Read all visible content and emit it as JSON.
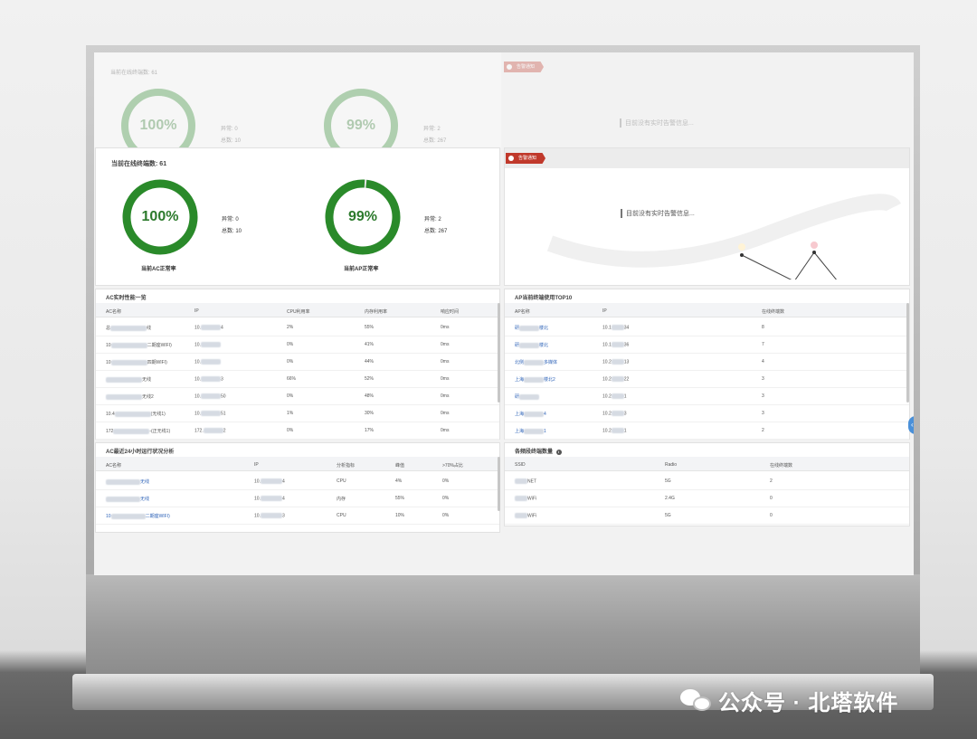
{
  "watermark": {
    "text": "公众号 · 北塔软件",
    "icon": "wechat-icon"
  },
  "online_terminals": {
    "label": "当前在线终端数:",
    "value": "61"
  },
  "ac_gauge": {
    "percent": "100%",
    "level": 1.0,
    "abnormal_label": "异常:",
    "abnormal": "0",
    "total_label": "总数:",
    "total": "10",
    "caption": "当前AC正常率"
  },
  "ap_gauge": {
    "percent": "99%",
    "level": 0.99,
    "abnormal_label": "异常:",
    "abnormal": "2",
    "total_label": "总数:",
    "total": "267",
    "caption": "当前AP正常率"
  },
  "alarm": {
    "tag": "告警通知",
    "empty_text": "目前没有实时告警信息..."
  },
  "ghost": {
    "online_terminals": "当前在线终端数: 61",
    "ac_percent": "100%",
    "ac_abnormal": "异常: 0",
    "ac_total": "总数: 10",
    "ap_percent": "99%",
    "ap_abnormal": "异常: 2",
    "ap_total": "总数: 267",
    "alarm_tag": "告警通知",
    "alarm_text": "目前没有实时告警信息..."
  },
  "ac_realtime": {
    "title": "AC实时性能一览",
    "headers": [
      "AC名称",
      "IP",
      "CPU利用率",
      "内存利用率",
      "响应时间"
    ],
    "rows": [
      {
        "name": "总",
        "name_suffix": "线",
        "ip": "10.",
        "ip_suffix": "4",
        "cpu": "2%",
        "mem": "55%",
        "resp": "0ms"
      },
      {
        "name": "10",
        "name_suffix": "二期座WIFI)",
        "ip": "10.",
        "ip_suffix": "",
        "cpu": "0%",
        "mem": "41%",
        "resp": "0ms"
      },
      {
        "name": "10",
        "name_suffix": "四期WIFI)",
        "ip": "10.",
        "ip_suffix": "",
        "cpu": "0%",
        "mem": "44%",
        "resp": "0ms"
      },
      {
        "name": "",
        "name_suffix": "无线",
        "ip": "10.",
        "ip_suffix": "3",
        "cpu": "66%",
        "mem": "52%",
        "resp": "0ms"
      },
      {
        "name": "",
        "name_suffix": "无线2",
        "ip": "10.",
        "ip_suffix": "50",
        "cpu": "0%",
        "mem": "48%",
        "resp": "0ms"
      },
      {
        "name": "10.4",
        "name_suffix": "(无线1)",
        "ip": "10.",
        "ip_suffix": "51",
        "cpu": "1%",
        "mem": "30%",
        "resp": "0ms"
      },
      {
        "name": "172",
        "name_suffix": "-(正无线1)",
        "ip": "172.",
        "ip_suffix": "2",
        "cpu": "0%",
        "mem": "17%",
        "resp": "0ms"
      }
    ]
  },
  "ap_top10": {
    "title": "AP当前终端使用TOP10",
    "headers": [
      "AP名称",
      "IP",
      "在线终端数"
    ],
    "rows": [
      {
        "name": "研",
        "name_suffix": "楼北",
        "ip": "10.1",
        "ip_suffix": "34",
        "count": "8"
      },
      {
        "name": "研",
        "name_suffix": "楼北",
        "ip": "10.1",
        "ip_suffix": "36",
        "count": "7"
      },
      {
        "name": "北侧",
        "name_suffix": "多媒体",
        "ip": "10.2",
        "ip_suffix": "13",
        "count": "4"
      },
      {
        "name": "上海",
        "name_suffix": "楼北2",
        "ip": "10.2",
        "ip_suffix": "22",
        "count": "3"
      },
      {
        "name": "研",
        "name_suffix": "",
        "ip": "10.2",
        "ip_suffix": "1",
        "count": "3"
      },
      {
        "name": "上海",
        "name_suffix": "4",
        "ip": "10.2",
        "ip_suffix": "3",
        "count": "3"
      },
      {
        "name": "上海",
        "name_suffix": "1",
        "ip": "10.2",
        "ip_suffix": "1",
        "count": "2"
      }
    ]
  },
  "ac_24h": {
    "title": "AC最近24小时运行状况分析",
    "headers": [
      "AC名称",
      "IP",
      "分析指标",
      "峰值",
      ">70%占比"
    ],
    "rows": [
      {
        "name": "",
        "name_suffix": "无线",
        "ip": "10.",
        "ip_suffix": "4",
        "metric": "CPU",
        "peak": "4%",
        "ratio": "0%"
      },
      {
        "name": "",
        "name_suffix": "无线",
        "ip": "10.",
        "ip_suffix": "4",
        "metric": "内存",
        "peak": "55%",
        "ratio": "0%"
      },
      {
        "name": "10",
        "name_suffix": "二期座WIFI)",
        "ip": "10.",
        "ip_suffix": "3",
        "metric": "CPU",
        "peak": "10%",
        "ratio": "0%"
      }
    ]
  },
  "wireless": {
    "title": "各频段终端数量",
    "info_icon": "info-icon",
    "headers": [
      "SSID",
      "Radio",
      "在线终端数"
    ],
    "rows": [
      {
        "ssid": "NET",
        "radio": "5G",
        "count": "2"
      },
      {
        "ssid": "WiFi",
        "radio": "2.4G",
        "count": "0"
      },
      {
        "ssid": "WiFi",
        "radio": "5G",
        "count": "0"
      }
    ]
  },
  "colors": {
    "ring_green": "#2a8a2a",
    "ring_track": "#e6e6e6",
    "alarm_red": "#c0392b",
    "link_blue": "#2e63b8"
  }
}
